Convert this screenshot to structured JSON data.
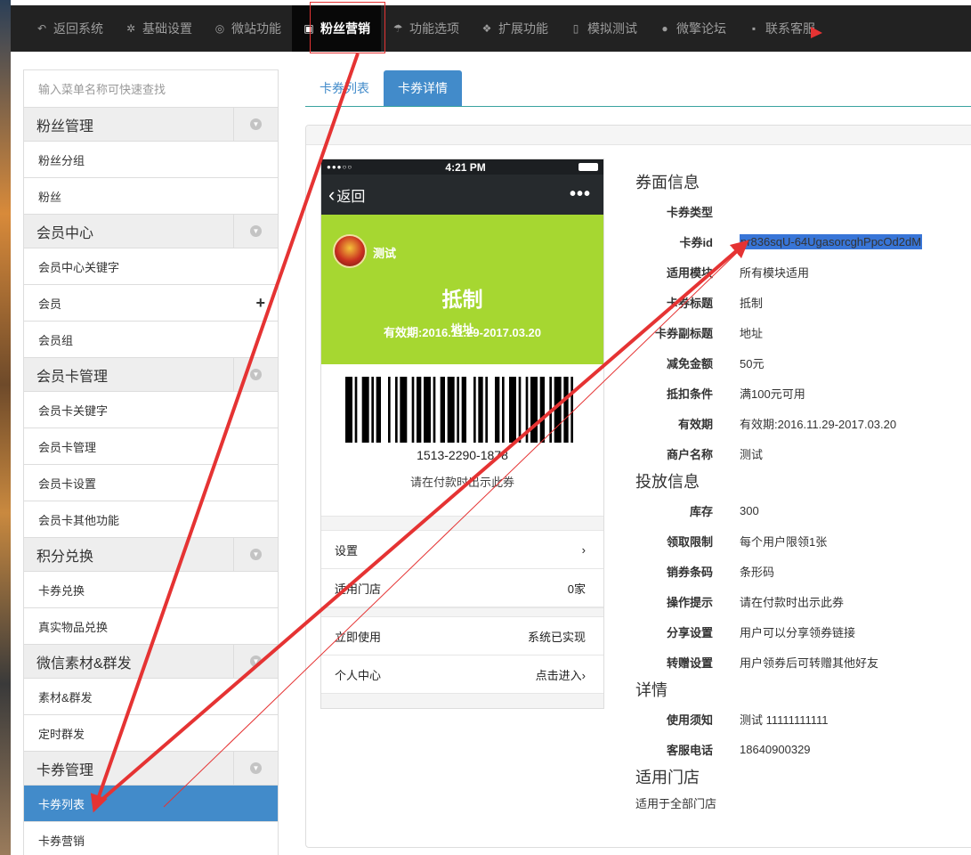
{
  "nav": {
    "items": [
      {
        "label": "返回系统",
        "icon": "undo-icon",
        "glyph": "↶"
      },
      {
        "label": "基础设置",
        "icon": "gear-icon",
        "glyph": "✲"
      },
      {
        "label": "微站功能",
        "icon": "life-ring-icon",
        "glyph": "◎"
      },
      {
        "label": "粉丝营销",
        "icon": "gift-icon",
        "glyph": "▣"
      },
      {
        "label": "功能选项",
        "icon": "umbrella-icon",
        "glyph": "☂"
      },
      {
        "label": "扩展功能",
        "icon": "cubes-icon",
        "glyph": "❖"
      },
      {
        "label": "模拟测试",
        "icon": "mobile-icon",
        "glyph": "▯"
      },
      {
        "label": "微擎论坛",
        "icon": "comment-icon",
        "glyph": "●"
      },
      {
        "label": "联系客服",
        "icon": "briefcase-icon",
        "glyph": "▪"
      }
    ]
  },
  "sidebar": {
    "search_placeholder": "输入菜单名称可快速查找",
    "groups": [
      {
        "title": "粉丝管理",
        "items": [
          "粉丝分组",
          "粉丝"
        ]
      },
      {
        "title": "会员中心",
        "items": [
          "会员中心关键字",
          "会员",
          "会员组"
        ]
      },
      {
        "title": "会员卡管理",
        "items": [
          "会员卡关键字",
          "会员卡管理",
          "会员卡设置",
          "会员卡其他功能"
        ]
      },
      {
        "title": "积分兑换",
        "items": [
          "卡券兑换",
          "真实物品兑换"
        ]
      },
      {
        "title": "微信素材&群发",
        "items": [
          "素材&群发",
          "定时群发"
        ]
      },
      {
        "title": "卡券管理",
        "items": [
          "卡券列表",
          "卡券营销"
        ]
      }
    ],
    "plus": "+"
  },
  "tabs": {
    "list": "卡券列表",
    "detail": "卡券详情"
  },
  "phone": {
    "status_time": "4:21 PM",
    "signal": "●●●○○",
    "back": "返回",
    "more": "•••",
    "merchant": "测试",
    "card_title": "抵制",
    "card_subtitle": "地址",
    "card_validity": "有效期:2016.11.29-2017.03.20",
    "barcode_number": "1513-2290-1878",
    "barcode_tip": "请在付款时出示此券",
    "rows": {
      "settings": "设置",
      "settings_arrow": "›",
      "stores": "适用门店",
      "stores_val": "0家",
      "use_now": "立即使用",
      "use_now_val": "系统已实现",
      "personal": "个人中心",
      "personal_val": "点击进入›"
    }
  },
  "info": {
    "face_title": "券面信息",
    "face": [
      {
        "label": "卡券类型",
        "value": ""
      },
      {
        "label": "卡券id",
        "value": "pr836sqU-64UgasorcghPpcOd2dM"
      },
      {
        "label": "适用模块",
        "value": "所有模块适用"
      },
      {
        "label": "卡券标题",
        "value": "抵制"
      },
      {
        "label": "卡券副标题",
        "value": "地址"
      },
      {
        "label": "减免金额",
        "value": "50元"
      },
      {
        "label": "抵扣条件",
        "value": "满100元可用"
      },
      {
        "label": "有效期",
        "value": "有效期:2016.11.29-2017.03.20"
      },
      {
        "label": "商户名称",
        "value": "测试"
      }
    ],
    "dist_title": "投放信息",
    "dist": [
      {
        "label": "库存",
        "value": "300"
      },
      {
        "label": "领取限制",
        "value": "每个用户限领1张"
      },
      {
        "label": "销券条码",
        "value": "条形码"
      },
      {
        "label": "操作提示",
        "value": "请在付款时出示此券"
      },
      {
        "label": "分享设置",
        "value": "用户可以分享领券链接"
      },
      {
        "label": "转赠设置",
        "value": "用户领券后可转赠其他好友"
      }
    ],
    "detail_title": "详情",
    "detail": [
      {
        "label": "使用须知",
        "value": "测试 11111111111"
      },
      {
        "label": "客服电话",
        "value": "18640900329"
      }
    ],
    "store_title": "适用门店",
    "store_text": "适用于全部门店"
  },
  "colors": {
    "nav_bg": "#222222",
    "accent": "#428bca",
    "card_green": "#a6d731",
    "annotation_red": "#e53333",
    "selection": "#3875d7"
  }
}
